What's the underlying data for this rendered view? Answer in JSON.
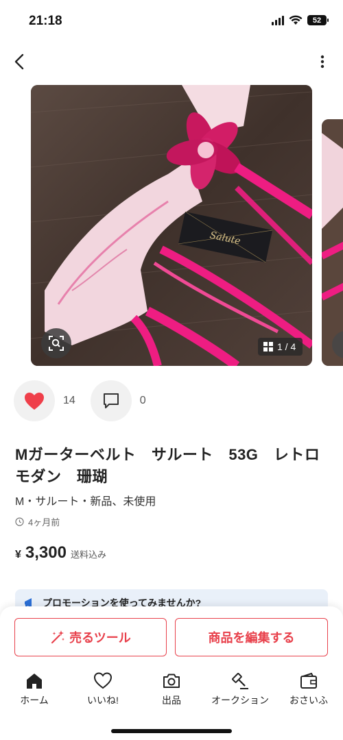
{
  "status_bar": {
    "time": "21:18",
    "battery": "52"
  },
  "gallery": {
    "page_indicator": "1 / 4",
    "image_count": 4,
    "current_image": 1
  },
  "reactions": {
    "likes": "14",
    "comments": "0"
  },
  "product": {
    "title": "Mガーターベルト　サルート　53G　レトロモダン　珊瑚",
    "subtitle": "M・サルート・新品、未使用",
    "posted": "4ヶ月前",
    "price_symbol": "¥",
    "price": "3,300",
    "price_note": "送料込み"
  },
  "promo": {
    "text": "プロモーションを使ってみませんか?"
  },
  "actions": {
    "sell_tool": "売るツール",
    "edit_product": "商品を編集する"
  },
  "tabs": [
    {
      "label": "ホーム",
      "icon": "home-icon"
    },
    {
      "label": "いいね!",
      "icon": "heart-icon"
    },
    {
      "label": "出品",
      "icon": "camera-icon"
    },
    {
      "label": "オークション",
      "icon": "gavel-icon"
    },
    {
      "label": "おさいふ",
      "icon": "wallet-icon"
    }
  ],
  "colors": {
    "accent": "#e8404b",
    "like_red": "#ef3f4a",
    "promo_bg": "#e9f0f9",
    "promo_icon": "#2b6fd6"
  }
}
